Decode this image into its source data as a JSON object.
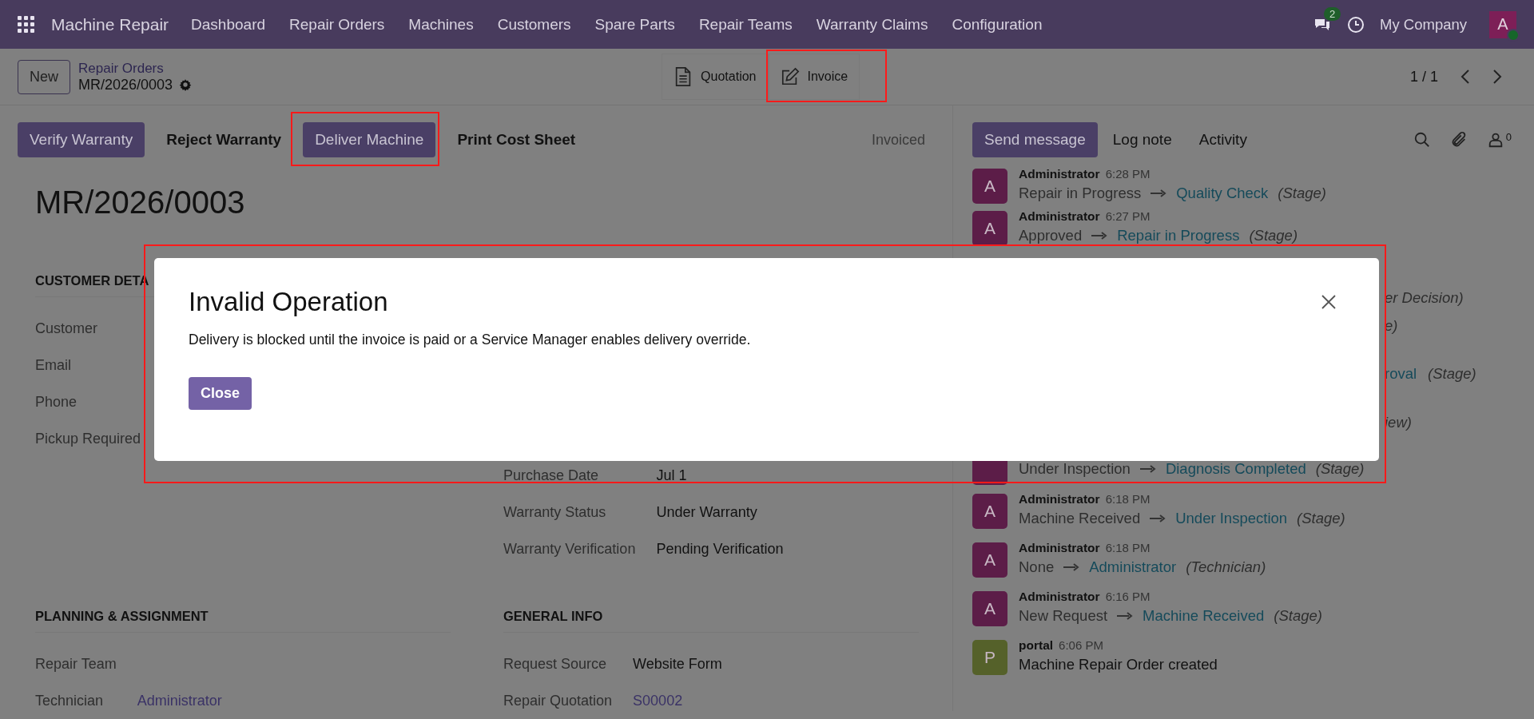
{
  "navbar": {
    "app_name": "Machine Repair",
    "menu": [
      "Dashboard",
      "Repair Orders",
      "Machines",
      "Customers",
      "Spare Parts",
      "Repair Teams",
      "Warranty Claims",
      "Configuration"
    ],
    "messages_badge": "2",
    "company": "My Company",
    "user_initial": "A"
  },
  "control_panel": {
    "new_button": "New",
    "breadcrumb": "Repair Orders",
    "record": "MR/2026/0003",
    "smart_buttons": [
      "Quotation",
      "Invoice"
    ],
    "pager": "1 / 1"
  },
  "actions": [
    {
      "label": "Verify Warranty",
      "primary": true
    },
    {
      "label": "Reject Warranty",
      "primary": false
    },
    {
      "label": "Deliver Machine",
      "primary": true
    },
    {
      "label": "Print Cost Sheet",
      "primary": false
    }
  ],
  "status": "Invoiced",
  "form": {
    "title": "MR/2026/0003",
    "top_left": {
      "heading": "CUSTOMER DETA",
      "fields": [
        {
          "label": "Customer"
        },
        {
          "label": "Email"
        },
        {
          "label": "Phone"
        },
        {
          "label": "Pickup Required"
        }
      ]
    },
    "top_right": {
      "fields": [
        {
          "label": "Purchase Date",
          "value": "Jul 1",
          "link": false
        },
        {
          "label": "Warranty Status",
          "value": "Under Warranty",
          "link": false
        },
        {
          "label": "Warranty Verification",
          "value": "Pending Verification",
          "link": false
        }
      ]
    },
    "bottom_left": {
      "heading": "PLANNING & ASSIGNMENT",
      "fields": [
        {
          "label": "Repair Team"
        },
        {
          "label": "Technician",
          "value": "Administrator",
          "link": true
        }
      ]
    },
    "bottom_right": {
      "heading": "GENERAL INFO",
      "fields": [
        {
          "label": "Request Source",
          "value": "Website Form",
          "link": false
        },
        {
          "label": "Repair Quotation",
          "value": "S00002",
          "link": true
        }
      ]
    }
  },
  "chatter": {
    "buttons": [
      {
        "label": "Send message",
        "primary": true
      },
      {
        "label": "Log note",
        "primary": false
      },
      {
        "label": "Activity",
        "primary": false
      }
    ],
    "followers": "0",
    "messages": [
      {
        "kind": "message",
        "initial": "A",
        "color": "#5c1d48",
        "author": "Administrator",
        "time": "6:28 PM",
        "old": "Repair in Progress",
        "new": "Quality Check",
        "field": "(Stage)"
      },
      {
        "kind": "message",
        "initial": "A",
        "color": "#5c1d48",
        "author": "Administrator",
        "time": "6:27 PM",
        "old": "Approved",
        "new": "Repair in Progress",
        "field": "(Stage)"
      },
      {
        "kind": "fragment",
        "field": "er Decision)"
      },
      {
        "kind": "fragment",
        "field": "e)"
      },
      {
        "kind": "fragment",
        "new": "roval",
        "field": "(Stage)"
      },
      {
        "kind": "fragment",
        "field": "iew)"
      },
      {
        "kind": "body",
        "color": "#5c1d48",
        "old": "Under Inspection",
        "new": "Diagnosis Completed",
        "field": "(Stage)"
      },
      {
        "kind": "message",
        "initial": "A",
        "color": "#5c1d48",
        "author": "Administrator",
        "time": "6:18 PM",
        "old": "Machine Received",
        "new": "Under Inspection",
        "field": "(Stage)"
      },
      {
        "kind": "message",
        "initial": "A",
        "color": "#5c1d48",
        "author": "Administrator",
        "time": "6:18 PM",
        "old": "None",
        "new": "Administrator",
        "field": "(Technician)"
      },
      {
        "kind": "message",
        "initial": "A",
        "color": "#5c1d48",
        "author": "Administrator",
        "time": "6:16 PM",
        "old": "New Request",
        "new": "Machine Received",
        "field": "(Stage)"
      },
      {
        "kind": "note",
        "initial": "P",
        "color": "#55612a",
        "author": "portal",
        "time": "6:06 PM",
        "text": "Machine Repair Order created"
      }
    ]
  },
  "dialog": {
    "title": "Invalid Operation",
    "message": "Delivery is blocked until the invoice is paid or a Service Manager enables delivery override.",
    "button": "Close"
  }
}
